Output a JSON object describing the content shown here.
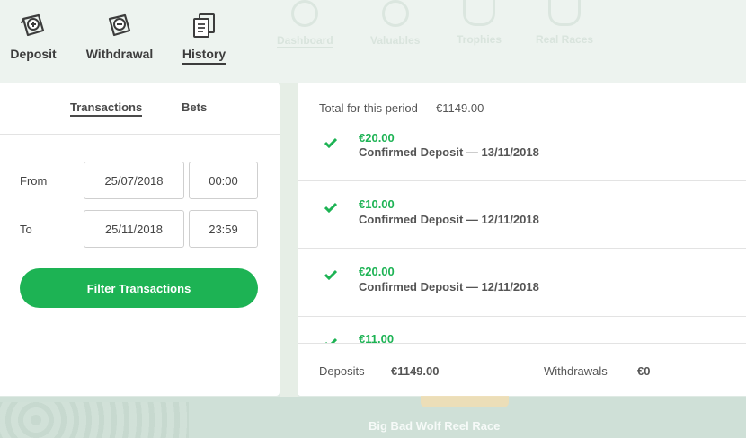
{
  "nav": {
    "deposit": "Deposit",
    "withdrawal": "Withdrawal",
    "history": "History"
  },
  "ghost_nav": [
    "Dashboard",
    "Valuables",
    "Trophies",
    "Real Races"
  ],
  "tabs": {
    "transactions": "Transactions",
    "bets": "Bets"
  },
  "filter": {
    "from_label": "From",
    "to_label": "To",
    "from_date": "25/07/2018",
    "from_time": "00:00",
    "to_date": "25/11/2018",
    "to_time": "23:59",
    "button": "Filter Transactions"
  },
  "total_text": "Total for this period — €1149.00",
  "transactions": [
    {
      "amount": "€20.00",
      "desc": "Confirmed Deposit — 13/11/2018"
    },
    {
      "amount": "€10.00",
      "desc": "Confirmed Deposit — 12/11/2018"
    },
    {
      "amount": "€20.00",
      "desc": "Confirmed Deposit — 12/11/2018"
    },
    {
      "amount": "€11.00",
      "desc": ""
    }
  ],
  "summary": {
    "deposits_label": "Deposits",
    "deposits_value": "€1149.00",
    "withdrawals_label": "Withdrawals",
    "withdrawals_value": "€0"
  },
  "background_banner": "Big Bad Wolf Reel Race",
  "colors": {
    "accent": "#1db354",
    "text": "#3c3c3c"
  }
}
